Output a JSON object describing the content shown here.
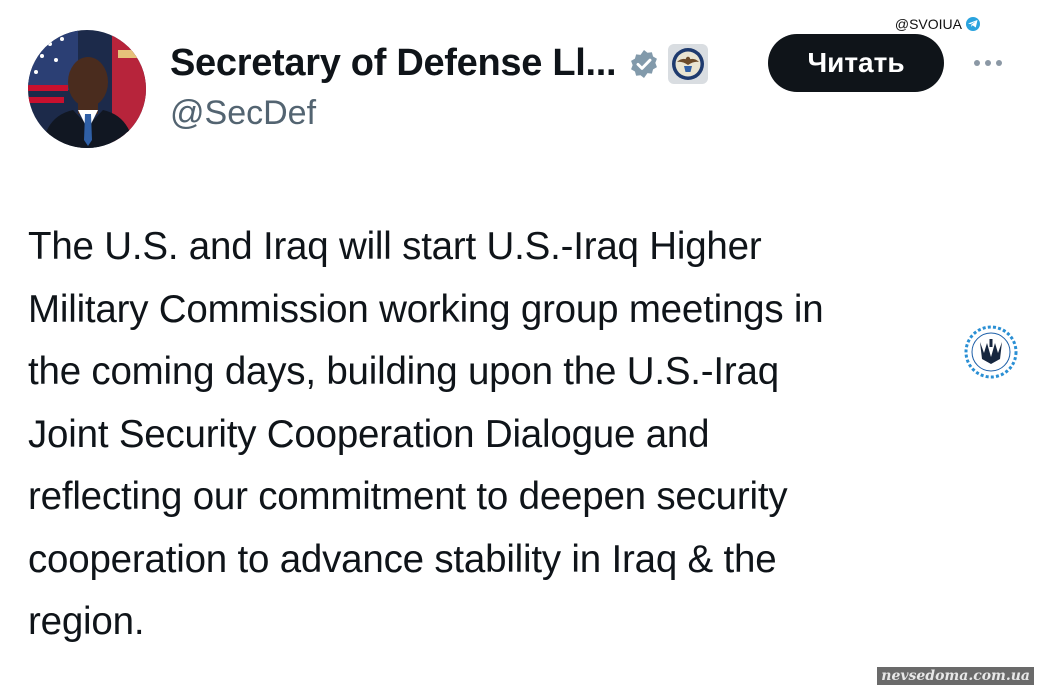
{
  "watermark_top": {
    "text": "@SVOIUA",
    "icon": "telegram-icon"
  },
  "account": {
    "display_name": "Secretary of Defense Ll...",
    "handle": "@SecDef",
    "verified_icon": "verified-badge-icon",
    "affiliation_icon": "department-of-defense-seal-icon"
  },
  "actions": {
    "follow_label": "Читать",
    "more_icon": "more-options-icon"
  },
  "tweet": {
    "text": "The U.S. and Iraq will start U.S.-Iraq Higher\nMilitary Commission working group meetings in\nthe coming days, building upon the U.S.-Iraq\nJoint Security Cooperation Dialogue and\nreflecting our commitment to deepen security\ncooperation to advance stability in Iraq & the\nregion."
  },
  "watermark_bottom": {
    "text": "nevsedoma.com.ua"
  },
  "colors": {
    "text_primary": "#0f1419",
    "text_secondary": "#536471",
    "verified": "#829aab",
    "button_bg": "#0f1419",
    "telegram": "#2aa3de"
  }
}
